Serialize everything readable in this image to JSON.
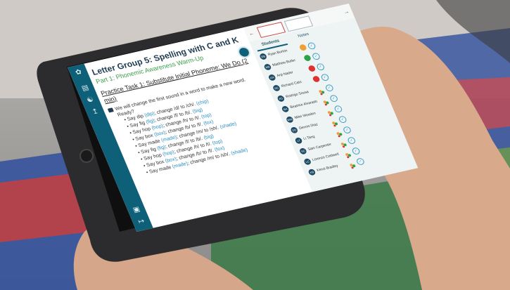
{
  "nav_rail": {
    "icons": [
      "logo-icon",
      "book-icon",
      "people-icon",
      "chart-icon",
      "cast-icon",
      "exit-icon"
    ]
  },
  "lesson": {
    "title": "Letter Group 5: Spelling with C and K",
    "subtitle": "Part 1: Phonemic Awareness Warm-Up",
    "task_title": "Practice Task 1: Substitute Initial Phoneme: We Do (2 min)",
    "intro": "We will change the first sound in a word to make a new word. Ready?",
    "items": [
      {
        "say": "Say dip",
        "phon": "(dip)",
        "change": "; change /d/ to /ch/.",
        "result": "(chip)"
      },
      {
        "say": "Say fig",
        "phon": "(fig)",
        "change": "; change /f/ to /b/.",
        "result": "(big)"
      },
      {
        "say": "Say hop",
        "phon": "(hop)",
        "change": "; change /h/ to /t/.",
        "result": "(top)"
      },
      {
        "say": "Say box",
        "phon": "(box)",
        "change": "; change /b/ to /f/.",
        "result": "(fox)"
      },
      {
        "say": "Say made",
        "phon": "(made)",
        "change": "; change /m/ to /sh/.",
        "result": "(shade)"
      },
      {
        "say": "Say fig",
        "phon": "(fig)",
        "change": "; change /f/ to /b/.",
        "result": "(big)"
      },
      {
        "say": "Say hop",
        "phon": "(hop)",
        "change": "; change /h/ to /t/.",
        "result": "(top)"
      },
      {
        "say": "Say box",
        "phon": "(box)",
        "change": "; change /b/ to /f/.",
        "result": "(fox)"
      },
      {
        "say": "Say made",
        "phon": "(made)",
        "change": "; change /m/ to /sh/.",
        "result": "(shade)"
      }
    ]
  },
  "panel": {
    "tabs": [
      "Students",
      "Notes"
    ],
    "students": [
      {
        "initials": "RB",
        "name": "Ryan Burton",
        "status_color": "#f0a030"
      },
      {
        "initials": "MB",
        "name": "Matthew Butler",
        "status_color": "#2aa24a"
      },
      {
        "initials": "AN",
        "name": "Anji Nader",
        "status_color": "#e03030"
      },
      {
        "initials": "RC",
        "name": "Richard Cato",
        "status_color": "#e03030"
      },
      {
        "initials": "RS",
        "name": "Rodrigo Sousa",
        "status_color": ""
      },
      {
        "initials": "BA",
        "name": "Beatrice Alvarado",
        "status_color": ""
      },
      {
        "initials": "MW",
        "name": "Mike Wooden",
        "status_color": ""
      },
      {
        "initials": "DD",
        "name": "Dennis Diaz",
        "status_color": ""
      },
      {
        "initials": "LT",
        "name": "Li Tang",
        "status_color": ""
      },
      {
        "initials": "SC",
        "name": "Sam Carpenter",
        "status_color": ""
      },
      {
        "initials": "LC",
        "name": "Lorenzo Coldwell",
        "status_color": ""
      },
      {
        "initials": "KB",
        "name": "Kenzi Bradley",
        "status_color": ""
      }
    ]
  },
  "colors": {
    "rail": "#0e5f78",
    "title": "#1e3b52",
    "subtitle": "#3aa04a",
    "link": "#2b8fc2"
  }
}
